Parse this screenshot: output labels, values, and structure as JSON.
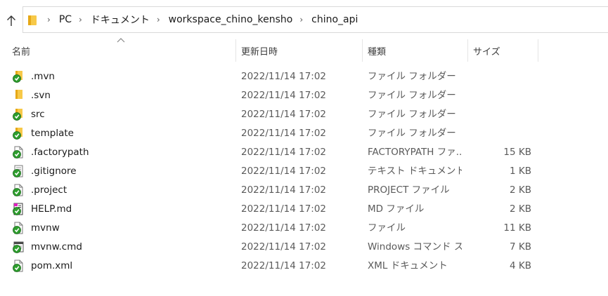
{
  "address": {
    "crumbs": [
      "PC",
      "ドキュメント",
      "workspace_chino_kensho",
      "chino_api"
    ]
  },
  "columns": {
    "name": "名前",
    "date": "更新日時",
    "type": "種類",
    "size": "サイズ"
  },
  "files": [
    {
      "name": ".mvn",
      "date": "2022/11/14 17:02",
      "type": "ファイル フォルダー",
      "size": "",
      "icon": "folder-check-icon"
    },
    {
      "name": ".svn",
      "date": "2022/11/14 17:02",
      "type": "ファイル フォルダー",
      "size": "",
      "icon": "folder-icon"
    },
    {
      "name": "src",
      "date": "2022/11/14 17:02",
      "type": "ファイル フォルダー",
      "size": "",
      "icon": "folder-check-icon"
    },
    {
      "name": "template",
      "date": "2022/11/14 17:02",
      "type": "ファイル フォルダー",
      "size": "",
      "icon": "folder-check-icon"
    },
    {
      "name": ".factorypath",
      "date": "2022/11/14 17:02",
      "type": "FACTORYPATH ファ...",
      "size": "15 KB",
      "icon": "file-check-icon"
    },
    {
      "name": ".gitignore",
      "date": "2022/11/14 17:02",
      "type": "テキスト ドキュメント",
      "size": "1 KB",
      "icon": "text-file-check-icon"
    },
    {
      "name": ".project",
      "date": "2022/11/14 17:02",
      "type": "PROJECT ファイル",
      "size": "2 KB",
      "icon": "file-check-icon"
    },
    {
      "name": "HELP.md",
      "date": "2022/11/14 17:02",
      "type": "MD ファイル",
      "size": "2 KB",
      "icon": "md-file-check-icon"
    },
    {
      "name": "mvnw",
      "date": "2022/11/14 17:02",
      "type": "ファイル",
      "size": "11 KB",
      "icon": "file-check-icon"
    },
    {
      "name": "mvnw.cmd",
      "date": "2022/11/14 17:02",
      "type": "Windows コマンド ス...",
      "size": "7 KB",
      "icon": "cmd-file-check-icon"
    },
    {
      "name": "pom.xml",
      "date": "2022/11/14 17:02",
      "type": "XML ドキュメント",
      "size": "4 KB",
      "icon": "file-check-icon"
    }
  ],
  "colors": {
    "folder": "#f7c948",
    "folder_dark": "#e6a817",
    "check_green": "#2e9e2e"
  }
}
